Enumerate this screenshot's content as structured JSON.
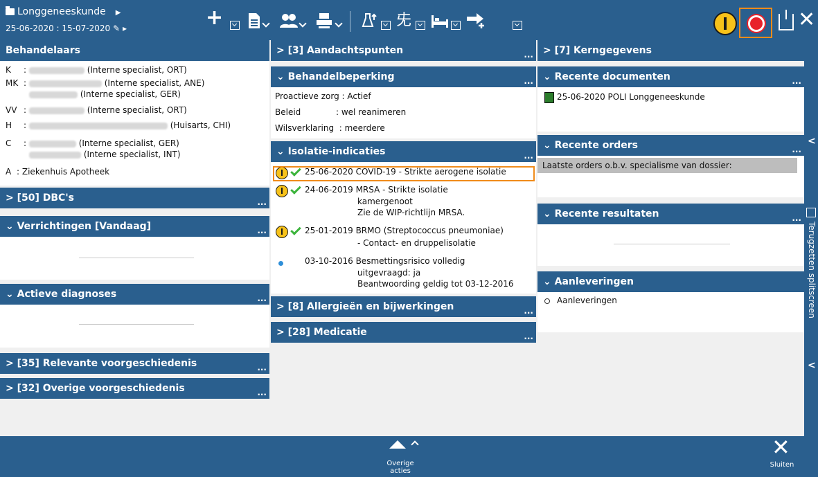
{
  "header": {
    "department": "Longgeneeskunde",
    "period": "25-06-2020 : 15-07-2020"
  },
  "toolbar": {
    "icons": [
      "add-icon",
      "document-icon",
      "group-icon",
      "printer-icon",
      "lab-icon",
      "walk-icon",
      "bed-icon",
      "transfer-icon",
      "warning-icon",
      "virus-icon",
      "exit-icon",
      "close-icon"
    ]
  },
  "left": {
    "behandelaars": {
      "title": "Behandelaars",
      "rows": [
        {
          "code": "K",
          "sep": ":",
          "role": "(Interne specialist, ORT)"
        },
        {
          "code": "MK",
          "sep": ":",
          "role": "(Interne specialist, ANE)"
        },
        {
          "code": "",
          "sep": "",
          "role": "(Interne specialist, GER)"
        },
        {
          "code": "VV",
          "sep": ":",
          "role": "(Interne specialist, ORT)"
        },
        {
          "code": "H",
          "sep": ":",
          "role": "(Huisarts, CHI)"
        },
        {
          "code": "C",
          "sep": ":",
          "role": "(Interne specialist, GER)"
        },
        {
          "code": "",
          "sep": "",
          "role": "(Interne specialist, INT)"
        },
        {
          "code": "A",
          "sep": ":",
          "role": "Ziekenhuis Apotheek"
        }
      ]
    },
    "dbc": "[50] DBC's",
    "verrichtingen": "Verrichtingen [Vandaag]",
    "diagnoses": "Actieve diagnoses",
    "relevante": "[35] Relevante voorgeschiedenis",
    "overige": "[32] Overige voorgeschiedenis"
  },
  "middle": {
    "aandacht": "[3] Aandachtspunten",
    "beperking": {
      "title": "Behandelbeperking",
      "rows": [
        {
          "label": "Proactieve zorg",
          "value": ": Actief"
        },
        {
          "label": "Beleid",
          "value": ": wel reanimeren"
        },
        {
          "label": "Wilsverklaring",
          "value": ": meerdere"
        }
      ]
    },
    "isolatie": {
      "title": "Isolatie-indicaties",
      "items": [
        {
          "date": "25-06-2020",
          "lines": [
            "COVID-19 - Strikte aerogene isolatie"
          ]
        },
        {
          "date": "24-06-2019",
          "lines": [
            "MRSA - Strikte isolatie",
            "kamergenoot",
            "Zie de WIP-richtlijn MRSA."
          ]
        },
        {
          "date": "25-01-2019",
          "lines": [
            "BRMO (Streptococcus pneumoniae)",
            "- Contact- en druppelisolatie"
          ]
        },
        {
          "date": "03-10-2016",
          "lines": [
            "Besmettingsrisico volledig",
            "uitgevraagd: ja",
            "Beantwoording geldig tot 03-12-2016"
          ]
        }
      ]
    },
    "allergie": "[8] Allergieën en bijwerkingen",
    "medicatie": "[28] Medicatie"
  },
  "right": {
    "kerngegevens": "[7] Kerngegevens",
    "documenten": {
      "title": "Recente documenten",
      "items": [
        "25-06-2020 POLI Longgeneeskunde"
      ]
    },
    "orders": {
      "title": "Recente orders",
      "note": "Laatste orders o.b.v. specialisme van dossier:"
    },
    "resultaten": "Recente resultaten",
    "aanleveringen": {
      "title": "Aanleveringen",
      "items": [
        "Aanleveringen"
      ]
    }
  },
  "sidebar": {
    "label": "Terugzetten splitscreen"
  },
  "footer": {
    "more_line1": "Overige",
    "more_line2": "acties",
    "close": "Sluiten"
  },
  "symbols": {
    "more": "...",
    "expand": ">",
    "collapse": "⌄"
  },
  "colors": {
    "header": "#2a5f8e",
    "highlight": "#f08b1a",
    "alert": "#e8222a",
    "warn": "#f7c21a"
  }
}
